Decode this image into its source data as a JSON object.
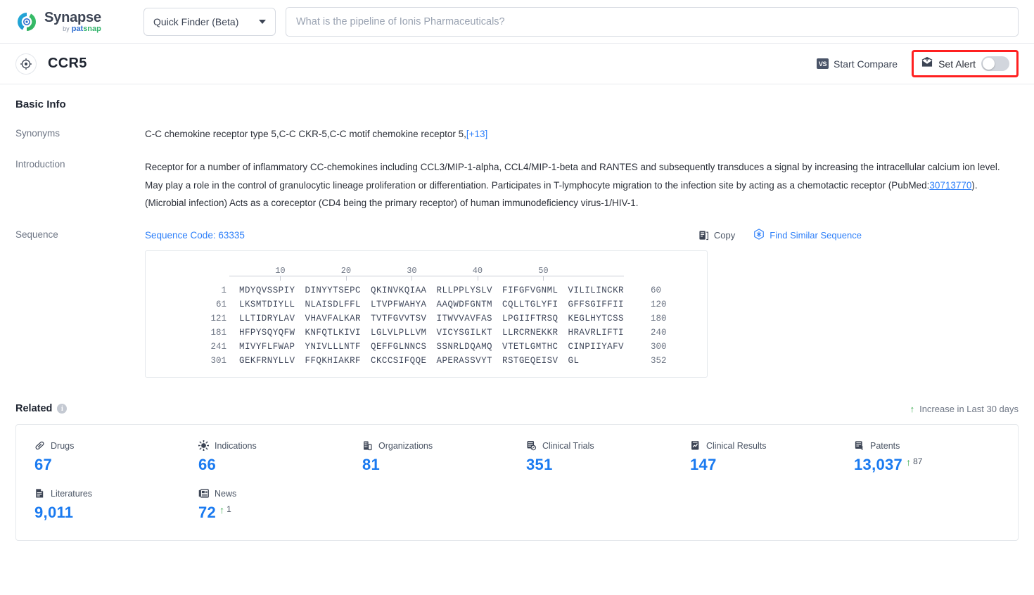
{
  "topbar": {
    "logo_name": "Synapse",
    "logo_by": "by",
    "logo_pat": "pat",
    "logo_snap": "snap",
    "finder_label": "Quick Finder (Beta)",
    "search_placeholder": "What is the pipeline of Ionis Pharmaceuticals?",
    "search_value": ""
  },
  "entitybar": {
    "title": "CCR5",
    "start_compare": "Start Compare",
    "vs_badge": "VS",
    "set_alert": "Set Alert",
    "alert_on": false,
    "highlight_color": "#ff2020"
  },
  "basic_info": {
    "heading": "Basic Info",
    "synonyms_label": "Synonyms",
    "synonyms_text": "C-C chemokine receptor type 5,C-C CKR-5,C-C motif chemokine receptor 5,",
    "synonyms_more": "[+13]",
    "introduction_label": "Introduction",
    "introduction_part1": "Receptor for a number of inflammatory CC-chemokines including CCL3/MIP-1-alpha, CCL4/MIP-1-beta and RANTES and subsequently transduces a signal by increasing the intracellular calcium ion level. May play a role in the control of granulocytic lineage proliferation or differentiation. Participates in T-lymphocyte migration to the infection site by acting as a chemotactic receptor (PubMed:",
    "pubmed_id": "30713770",
    "introduction_part2": "). (Microbial infection) Acts as a coreceptor (CD4 being the primary receptor) of human immunodeficiency virus-1/HIV-1."
  },
  "sequence": {
    "label": "Sequence",
    "code_label": "Sequence Code: 63335",
    "copy_label": "Copy",
    "find_similar_label": "Find Similar Sequence",
    "ruler_ticks": [
      10,
      20,
      30,
      40,
      50
    ],
    "lines": [
      {
        "start": "1",
        "chunks": [
          "MDYQVSSPIY",
          "DINYYTSEPC",
          "QKINVKQIAA",
          "RLLPPLYSLV",
          "FIFGFVGNML",
          "VILILINCKR"
        ],
        "end": "60"
      },
      {
        "start": "61",
        "chunks": [
          "LKSMTDIYLL",
          "NLAISDLFFL",
          "LTVPFWAHYA",
          "AAQWDFGNTM",
          "CQLLTGLYFI",
          "GFFSGIFFII"
        ],
        "end": "120"
      },
      {
        "start": "121",
        "chunks": [
          "LLTIDRYLAV",
          "VHAVFALKAR",
          "TVTFGVVTSV",
          "ITWVVAVFAS",
          "LPGIIFTRSQ",
          "KEGLHYTCSS"
        ],
        "end": "180"
      },
      {
        "start": "181",
        "chunks": [
          "HFPYSQYQFW",
          "KNFQTLKIVI",
          "LGLVLPLLVM",
          "VICYSGILKT",
          "LLRCRNEKKR",
          "HRAVRLIFTI"
        ],
        "end": "240"
      },
      {
        "start": "241",
        "chunks": [
          "MIVYFLFWAP",
          "YNIVLLLNTF",
          "QEFFGLNNCS",
          "SSNRLDQAMQ",
          "VTETLGMTHC",
          "CINPIIYAFV"
        ],
        "end": "300"
      },
      {
        "start": "301",
        "chunks": [
          "GEKFRNYLLV",
          "FFQKHIAKRF",
          "CKCCSIFQQE",
          "APERASSVYT",
          "RSTGEQEISV",
          "GL"
        ],
        "end": "352"
      }
    ]
  },
  "related": {
    "title": "Related",
    "info_char": "i",
    "increase_note": "Increase in Last 30 days",
    "arrow_char": "↑",
    "accent_blue": "#1a7af0",
    "increase_green": "#3aaa4e",
    "items": [
      {
        "icon": "pill-icon",
        "label": "Drugs",
        "value": "67",
        "delta": ""
      },
      {
        "icon": "virus-icon",
        "label": "Indications",
        "value": "66",
        "delta": ""
      },
      {
        "icon": "building-icon",
        "label": "Organizations",
        "value": "81",
        "delta": ""
      },
      {
        "icon": "clinical-trial-icon",
        "label": "Clinical Trials",
        "value": "351",
        "delta": ""
      },
      {
        "icon": "clinical-result-icon",
        "label": "Clinical Results",
        "value": "147",
        "delta": ""
      },
      {
        "icon": "patent-icon",
        "label": "Patents",
        "value": "13,037",
        "delta": "87"
      },
      {
        "icon": "literature-icon",
        "label": "Literatures",
        "value": "9,011",
        "delta": ""
      },
      {
        "icon": "news-icon",
        "label": "News",
        "value": "72",
        "delta": "1"
      }
    ]
  }
}
